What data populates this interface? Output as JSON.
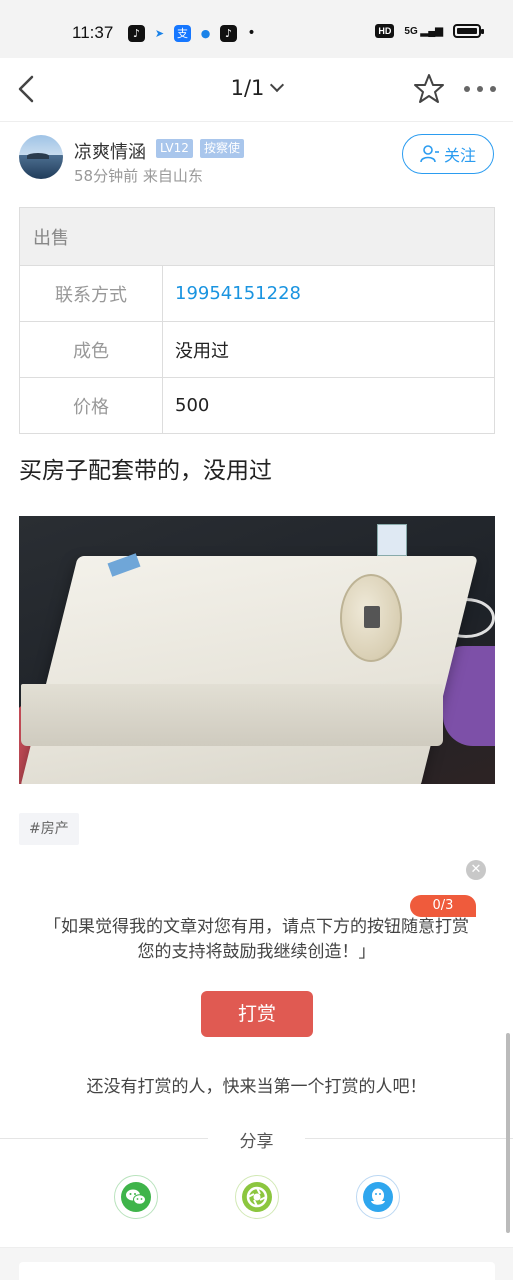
{
  "status_bar": {
    "time": "11:37",
    "hd": "HD",
    "signal": "5G",
    "notification_icons": [
      "douyin-icon",
      "paper-plane-icon",
      "alipay-icon",
      "circle-app-icon",
      "douyin-icon"
    ]
  },
  "nav": {
    "page_indicator": "1/1"
  },
  "author": {
    "name": "凉爽情涵",
    "level": "LV12",
    "role": "按察使",
    "meta": "58分钟前  来自山东",
    "follow_label": "关注"
  },
  "listing": {
    "header": "出售",
    "rows": [
      {
        "key": "联系方式",
        "value": "19954151228"
      },
      {
        "key": "成色",
        "value": "没用过"
      },
      {
        "key": "价格",
        "value": "500"
      }
    ]
  },
  "post": {
    "text": "买房子配套带的，没用过",
    "tag": "#房产"
  },
  "reward": {
    "counter": "0/3",
    "line1": "「如果觉得我的文章对您有用，请点下方的按钮随意打赏",
    "line2": "您的支持将鼓励我继续创造！」",
    "button_label": "打赏",
    "empty_text": "还没有打赏的人，快来当第一个打赏的人吧！"
  },
  "share": {
    "label": "分享",
    "targets": [
      "wechat-icon",
      "moments-icon",
      "qq-icon"
    ]
  },
  "colors": {
    "accent_blue": "#2b9cf0",
    "link_blue": "#1a94e0",
    "reward_red": "#e05a52",
    "badge_blue": "#a9c6ec",
    "counter_orange": "#ef5b3c"
  }
}
